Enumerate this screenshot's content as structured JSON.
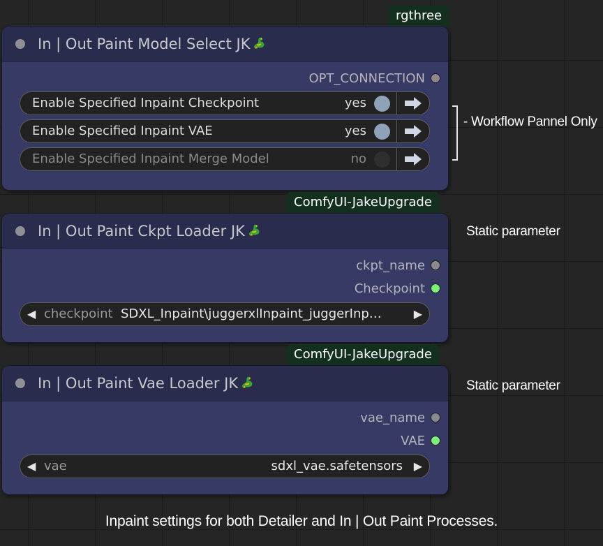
{
  "colors": {
    "node_body": "#383a66",
    "node_header": "#2a2c4d",
    "source_tag_bg": "#13301f",
    "slot_green": "#7cf07c",
    "slot_grey": "#8a8a90"
  },
  "nodes": [
    {
      "source": "rgthree",
      "title": "In | Out Paint Model Select JK",
      "title_icon": "dragon-emoji-icon",
      "outputs": [
        {
          "label": "OPT_CONNECTION",
          "slot": "grey"
        }
      ],
      "toggles": [
        {
          "label": "Enable Specified Inpaint Checkpoint",
          "value": "yes",
          "enabled": true,
          "icon": "arrow-right-icon"
        },
        {
          "label": "Enable Specified Inpaint VAE",
          "value": "yes",
          "enabled": true,
          "icon": "arrow-right-icon"
        },
        {
          "label": "Enable Specified Inpaint Merge Model",
          "value": "no",
          "enabled": false,
          "icon": "arrow-right-icon"
        }
      ]
    },
    {
      "source": "ComfyUI-JakeUpgrade",
      "title": "In | Out Paint Ckpt Loader JK",
      "title_icon": "dragon-emoji-icon",
      "outputs": [
        {
          "label": "ckpt_name",
          "slot": "grey"
        },
        {
          "label": "Checkpoint",
          "slot": "green"
        }
      ],
      "combo": {
        "name": "checkpoint",
        "value": "SDXL_Inpaint\\juggerxlInpaint_juggerInp…",
        "left_arrow": "◀",
        "right_arrow": "▶"
      }
    },
    {
      "source": "ComfyUI-JakeUpgrade",
      "title": "In | Out Paint Vae Loader JK",
      "title_icon": "dragon-emoji-icon",
      "outputs": [
        {
          "label": "vae_name",
          "slot": "grey"
        },
        {
          "label": "VAE",
          "slot": "green"
        }
      ],
      "combo": {
        "name": "vae",
        "value": "sdxl_vae.safetensors",
        "left_arrow": "◀",
        "right_arrow": "▶"
      }
    }
  ],
  "annotations": {
    "workflow_panel": "- Workflow Pannel Only",
    "static_1": "Static parameter",
    "static_2": "Static parameter"
  },
  "caption": "Inpaint settings for both Detailer and In | Out Paint Processes."
}
